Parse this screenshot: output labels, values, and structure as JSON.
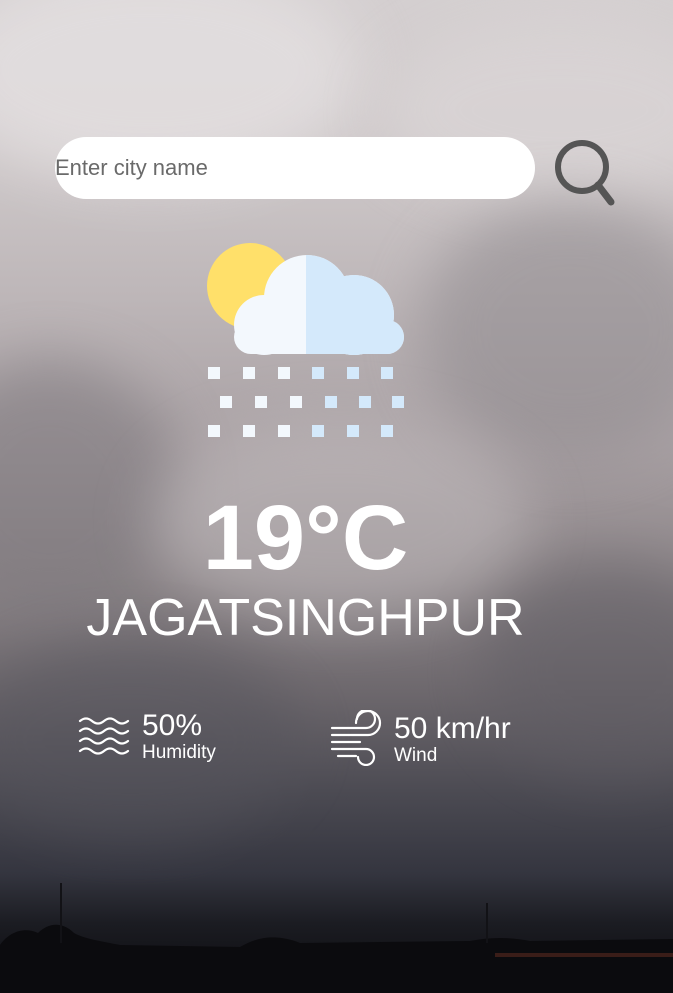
{
  "search": {
    "placeholder": "Enter city name",
    "value": ""
  },
  "icons": {
    "search": "search-icon",
    "weather": "cloud-sun-snow-icon",
    "humidity": "humidity-waves-icon",
    "wind": "wind-icon"
  },
  "weather": {
    "temperature": "19°C",
    "city": "JAGATSINGHPUR",
    "humidity_value": "50%",
    "humidity_label": "Humidity",
    "wind_value": "50 km/hr",
    "wind_label": "Wind"
  },
  "colors": {
    "text": "#ffffff",
    "search_bg": "#ffffff",
    "search_icon": "#555555",
    "sun": "#ffe06a",
    "cloud_left": "#f3f8fd",
    "cloud_right": "#d4e9fb"
  }
}
